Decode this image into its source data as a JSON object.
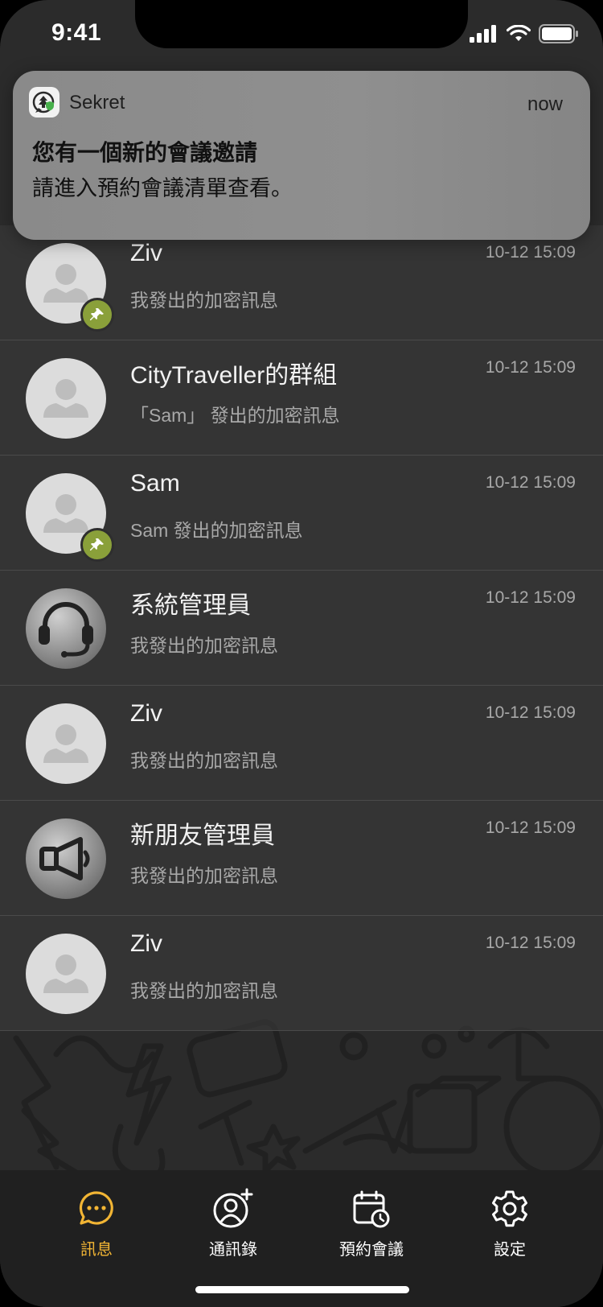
{
  "status_bar": {
    "time": "9:41"
  },
  "notification": {
    "app_name": "Sekret",
    "time": "now",
    "title": "您有一個新的會議邀請",
    "body": "請進入預約會議清單查看。"
  },
  "chats": [
    {
      "name": "Ziv",
      "preview": "我發出的加密訊息",
      "time": "10-12 15:09",
      "avatar": "person",
      "pinned": true
    },
    {
      "name": "CityTraveller的群組",
      "preview": "「Sam」 發出的加密訊息",
      "time": "10-12 15:09",
      "avatar": "person",
      "pinned": false
    },
    {
      "name": "Sam",
      "preview": "Sam 發出的加密訊息",
      "time": "10-12 15:09",
      "avatar": "person",
      "pinned": true
    },
    {
      "name": "系統管理員",
      "preview": "我發出的加密訊息",
      "time": "10-12 15:09",
      "avatar": "headset-icon",
      "pinned": false
    },
    {
      "name": "Ziv",
      "preview": "我發出的加密訊息",
      "time": "10-12 15:09",
      "avatar": "person",
      "pinned": false
    },
    {
      "name": "新朋友管理員",
      "preview": "我發出的加密訊息",
      "time": "10-12 15:09",
      "avatar": "megaphone-icon",
      "pinned": false
    },
    {
      "name": "Ziv",
      "preview": "我發出的加密訊息",
      "time": "10-12 15:09",
      "avatar": "person",
      "pinned": false
    }
  ],
  "tabs": [
    {
      "label": "訊息",
      "icon": "chat-bubble-icon",
      "active": true
    },
    {
      "label": "通訊錄",
      "icon": "add-contact-icon",
      "active": false
    },
    {
      "label": "預約會議",
      "icon": "calendar-clock-icon",
      "active": false
    },
    {
      "label": "設定",
      "icon": "gear-icon",
      "active": false
    }
  ],
  "colors": {
    "accent": "#f2b534",
    "pin_badge": "#8aa03a",
    "background": "#2b2b2b",
    "tab_bar": "#202020"
  }
}
